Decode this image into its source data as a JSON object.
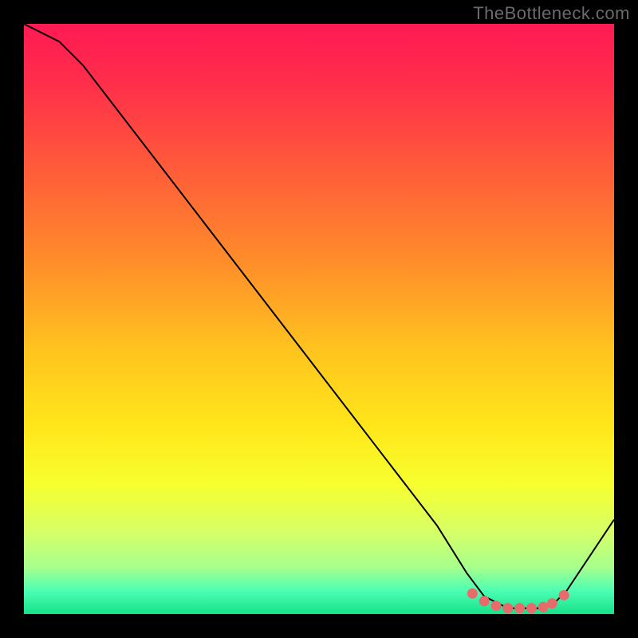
{
  "watermark": "TheBottleneck.com",
  "chart_data": {
    "type": "line",
    "title": "",
    "xlabel": "",
    "ylabel": "",
    "xlim": [
      0,
      100
    ],
    "ylim": [
      0,
      100
    ],
    "series": [
      {
        "name": "curve",
        "x": [
          0,
          6,
          10,
          20,
          30,
          40,
          50,
          60,
          70,
          75,
          78,
          82,
          86,
          88,
          90,
          92,
          100
        ],
        "y": [
          100,
          97,
          93,
          80,
          67,
          54,
          41,
          28,
          15,
          7,
          3,
          1,
          1,
          1,
          2,
          4,
          16
        ]
      }
    ],
    "markers": {
      "name": "dots",
      "x": [
        76,
        78,
        80,
        82,
        84,
        86,
        88,
        89.5,
        91.5
      ],
      "y": [
        3.5,
        2.2,
        1.4,
        1.0,
        1.0,
        1.0,
        1.2,
        1.8,
        3.2
      ]
    },
    "gradient_stops": [
      {
        "offset": 0.0,
        "color": "#ff1a54"
      },
      {
        "offset": 0.1,
        "color": "#ff2e4a"
      },
      {
        "offset": 0.24,
        "color": "#ff5a3a"
      },
      {
        "offset": 0.4,
        "color": "#ff8c2a"
      },
      {
        "offset": 0.55,
        "color": "#ffc31f"
      },
      {
        "offset": 0.68,
        "color": "#ffe61a"
      },
      {
        "offset": 0.78,
        "color": "#f7ff2e"
      },
      {
        "offset": 0.86,
        "color": "#d6ff66"
      },
      {
        "offset": 0.92,
        "color": "#a8ff8c"
      },
      {
        "offset": 0.96,
        "color": "#4dffb3"
      },
      {
        "offset": 1.0,
        "color": "#16e08a"
      }
    ],
    "marker_color": "#e86a6a",
    "line_color": "#000000"
  }
}
